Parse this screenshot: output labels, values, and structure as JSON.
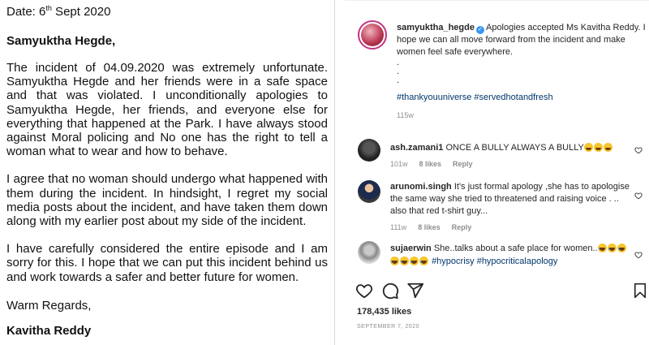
{
  "letter": {
    "date_prefix": "Date: 6",
    "date_sup": "th",
    "date_suffix": " Sept 2020",
    "salutation": "Samyuktha Hegde,",
    "paragraphs": [
      "The incident of 04.09.2020 was extremely unfortunate. Samyuktha Hegde and her friends were in a safe space and that was violated. I unconditionally apologies to Samyuktha Hegde, her friends, and everyone else for everything that happened at the Park. I have always stood against Moral policing and No one has the right to tell a woman what to wear and how to behave.",
      "I agree that no woman should undergo what happened with them during the incident. In hindsight, I regret my social media posts about the incident, and have taken them down along with my earlier post about my side of the incident.",
      "I have carefully considered the entire episode and I am sorry for this. I hope that we can put this incident behind us and work towards a safer and better future for women."
    ],
    "closing": "Warm Regards,",
    "signature": "Kavitha Reddy"
  },
  "post": {
    "caption": {
      "username": "samyuktha_hegde",
      "verified_icon": "verified-badge-icon",
      "text": "Apologies accepted Ms Kavitha Reddy. I hope we can all move forward from the incident and make women feel safe everywhere.",
      "dots": [
        ".",
        ".",
        "."
      ],
      "hashtags": "#thankyouuniverse #servedhotandfresh",
      "time": "115w"
    },
    "comments": [
      {
        "username": "ash.zamani1",
        "text": "ONCE A BULLY ALWAYS A BULLY",
        "emojis": [
          "grin",
          "grin",
          "grin"
        ],
        "time": "101w",
        "likes": "8 likes",
        "reply": "Reply"
      },
      {
        "username": "arunomi.singh",
        "text": "It's just formal apology ,she has to apologise the same way she tried to threatened and raising voice . .. also that red t-shirt guy...",
        "time": "111w",
        "likes": "8 likes",
        "reply": "Reply"
      },
      {
        "username": "sujaerwin",
        "text": "She..talks about a safe place for women..",
        "emojis_line1": [
          "laugh",
          "laugh",
          "laugh"
        ],
        "emojis_line2": [
          "laugh",
          "laugh",
          "laugh",
          "laugh"
        ],
        "hashtags": "#hypocrisy #hypocriticalapology"
      }
    ],
    "likes": "178,435 likes",
    "date": "SEPTEMBER 7, 2020",
    "icons": {
      "like": "heart-icon",
      "comment": "comment-icon",
      "share": "share-icon",
      "save": "bookmark-icon"
    },
    "colors": {
      "hashtag": "#00376b",
      "meta": "#8e8e8e",
      "verified": "#3897f0",
      "story_ring": "#c13584"
    }
  }
}
